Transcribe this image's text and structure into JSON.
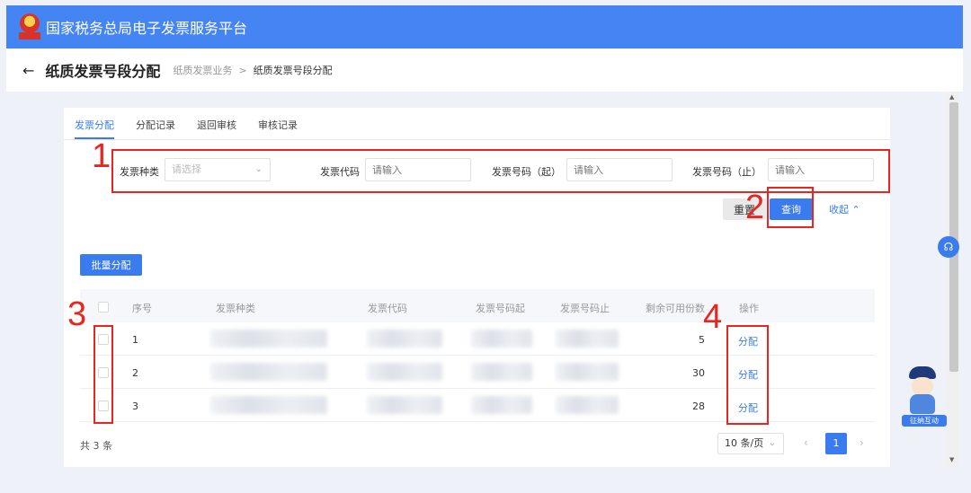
{
  "app": {
    "title": "国家税务总局电子发票服务平台"
  },
  "header": {
    "title": "纸质发票号段分配",
    "breadcrumb": [
      "纸质发票业务",
      "纸质发票号段分配"
    ],
    "breadcrumb_sep": ">"
  },
  "tabs": [
    "发票分配",
    "分配记录",
    "退回审核",
    "审核记录"
  ],
  "filters": [
    {
      "label": "发票种类",
      "placeholder": "请选择"
    },
    {
      "label": "发票代码",
      "placeholder": "请输入"
    },
    {
      "label": "发票号码（起）",
      "placeholder": "请输入"
    },
    {
      "label": "发票号码（止）",
      "placeholder": "请输入"
    }
  ],
  "actions": {
    "reset": "重置",
    "query": "查询",
    "collapse": "收起"
  },
  "batch_label": "批量分配",
  "table": {
    "headers": [
      "序号",
      "发票种类",
      "发票代码",
      "发票号码起",
      "发票号码止",
      "剩余可用份数",
      "操作"
    ],
    "rows": [
      {
        "index": "1",
        "remaining": "5",
        "action": "分配"
      },
      {
        "index": "2",
        "remaining": "30",
        "action": "分配"
      },
      {
        "index": "3",
        "remaining": "28",
        "action": "分配"
      }
    ]
  },
  "pagination": {
    "total": "共 3 条",
    "page_size": "10 条/页",
    "current": "1"
  },
  "annotations": [
    "1",
    "2",
    "3",
    "4"
  ],
  "widgets": {
    "mascot_label": "征纳互动"
  },
  "colors": {
    "topbar": "#4584f3",
    "primary": "#3a7cf0",
    "annotation": "#e8261f"
  }
}
